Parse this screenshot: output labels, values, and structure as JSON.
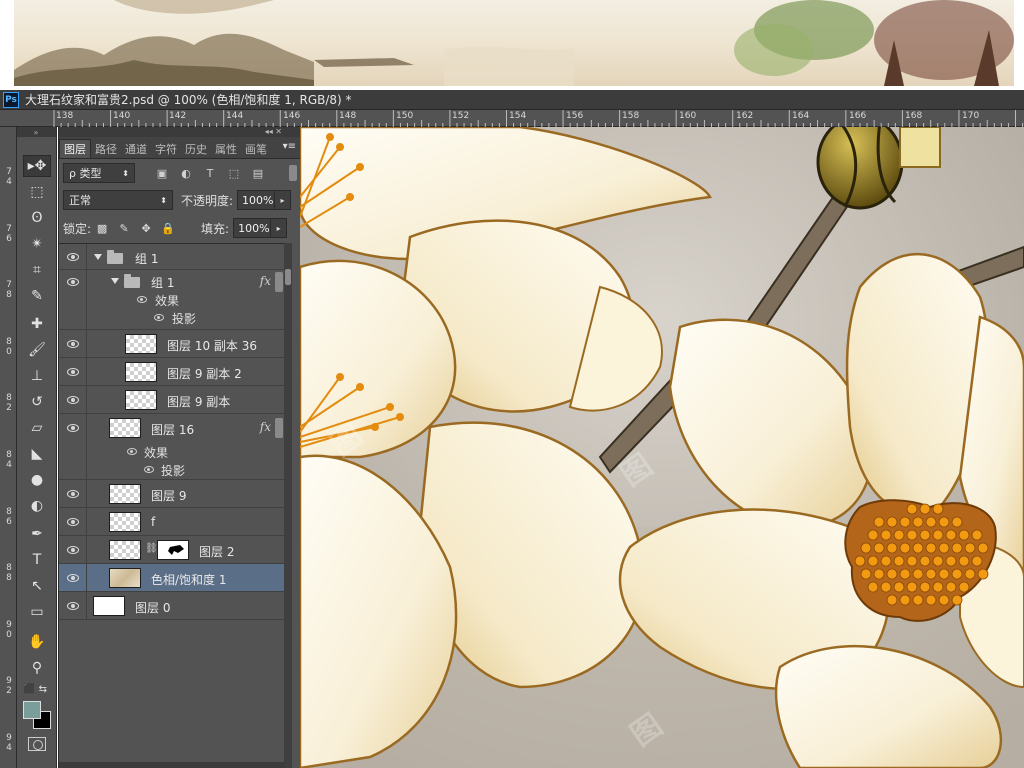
{
  "document": {
    "app_badge": "Ps",
    "title": "大理石纹家和富贵2.psd @ 100% (色相/饱和度 1, RGB/8) *"
  },
  "ruler": {
    "h_labels": [
      "138",
      "140",
      "142",
      "144",
      "146",
      "148",
      "150",
      "152",
      "154",
      "156",
      "158",
      "160",
      "162",
      "164",
      "166",
      "168",
      "170"
    ],
    "v_labels": [
      "7\n4",
      "7\n6",
      "7\n8",
      "8\n0",
      "8\n2",
      "8\n4",
      "8\n6",
      "8\n8",
      "9\n0",
      "9\n2",
      "9\n4"
    ]
  },
  "toolbar": {
    "tools": [
      {
        "icon": "move-tool-icon",
        "glyph": "▸✥",
        "active": true
      },
      {
        "icon": "marquee-tool-icon",
        "glyph": "⬚"
      },
      {
        "icon": "lasso-tool-icon",
        "glyph": "ʘ"
      },
      {
        "icon": "quick-select-tool-icon",
        "glyph": "✴"
      },
      {
        "icon": "crop-tool-icon",
        "glyph": "⌗"
      },
      {
        "icon": "eyedropper-tool-icon",
        "glyph": "✎"
      },
      {
        "icon": "healing-brush-tool-icon",
        "glyph": "✚"
      },
      {
        "icon": "brush-tool-icon",
        "glyph": "🖌"
      },
      {
        "icon": "clone-stamp-tool-icon",
        "glyph": "⊥"
      },
      {
        "icon": "history-brush-tool-icon",
        "glyph": "↺"
      },
      {
        "icon": "eraser-tool-icon",
        "glyph": "▱"
      },
      {
        "icon": "paint-bucket-tool-icon",
        "glyph": "◣"
      },
      {
        "icon": "blur-tool-icon",
        "glyph": "●"
      },
      {
        "icon": "dodge-tool-icon",
        "glyph": "◐"
      },
      {
        "icon": "pen-tool-icon",
        "glyph": "✒"
      },
      {
        "icon": "type-tool-icon",
        "glyph": "T"
      },
      {
        "icon": "path-select-tool-icon",
        "glyph": "↖"
      },
      {
        "icon": "rectangle-tool-icon",
        "glyph": "▭"
      },
      {
        "icon": "hand-tool-icon",
        "glyph": "✋"
      },
      {
        "icon": "zoom-tool-icon",
        "glyph": "⚲"
      }
    ],
    "foreground_color": "#7a9f9a",
    "background_color": "#000000"
  },
  "layers_panel": {
    "tabs": [
      "图层",
      "路径",
      "通道",
      "字符",
      "历史",
      "属性",
      "画笔"
    ],
    "active_tab": "图层",
    "filter": {
      "kind_label": "ρ 类型"
    },
    "blend_mode": "正常",
    "opacity_label": "不透明度:",
    "opacity_value": "100%",
    "lock_label": "锁定:",
    "fill_label": "填充:",
    "fill_value": "100%",
    "effects_label": "效果",
    "drop_shadow_label": "投影",
    "fx_label": "fx",
    "layers": [
      {
        "name": "组 1",
        "type": "group"
      },
      {
        "name": "组 1",
        "type": "group"
      },
      {
        "name": "图层 10 副本 36",
        "type": "layer"
      },
      {
        "name": "图层 9 副本 2",
        "type": "layer"
      },
      {
        "name": "图层 9 副本",
        "type": "layer"
      },
      {
        "name": "图层 16",
        "type": "layer"
      },
      {
        "name": "图层 9",
        "type": "layer"
      },
      {
        "name": "f",
        "type": "layer"
      },
      {
        "name": "图层 2",
        "type": "masked-layer"
      },
      {
        "name": "色相/饱和度 1",
        "type": "adjustment",
        "selected": true
      },
      {
        "name": "图层 0",
        "type": "layer"
      }
    ]
  },
  "colors": {
    "panel_bg": "#535353",
    "selection": "#5b6e87",
    "petal": "#fbf6e6",
    "stamen": "#e38c0f"
  }
}
